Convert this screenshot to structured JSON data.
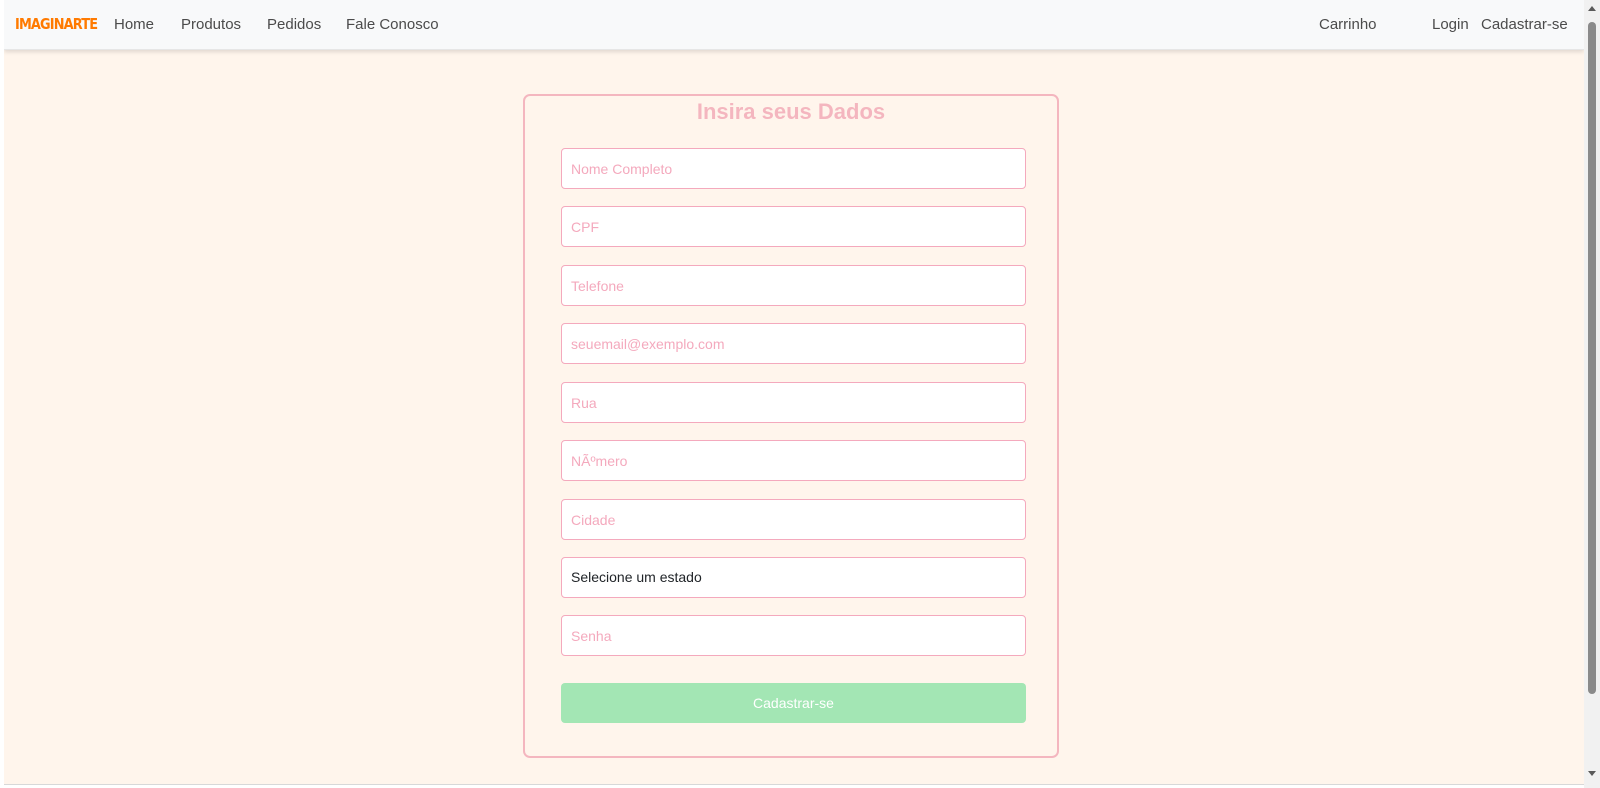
{
  "navbar": {
    "brand": "IMAGINARTE",
    "links": [
      "Home",
      "Produtos",
      "Pedidos",
      "Fale Conosco"
    ],
    "right_links": [
      "Carrinho",
      "Login",
      "Cadastrar-se"
    ]
  },
  "form": {
    "title": "Insira seus Dados",
    "fields": [
      {
        "placeholder": "Nome Completo",
        "value": ""
      },
      {
        "placeholder": "CPF",
        "value": ""
      },
      {
        "placeholder": "Telefone",
        "value": ""
      },
      {
        "placeholder": "seuemail@exemplo.com",
        "value": ""
      },
      {
        "placeholder": "Rua",
        "value": ""
      },
      {
        "placeholder": "NÃºmero",
        "value": ""
      },
      {
        "placeholder": "Cidade",
        "value": ""
      }
    ],
    "state_select": {
      "selected": "Selecione um estado"
    },
    "password": {
      "placeholder": "Senha",
      "value": ""
    },
    "submit_label": "Cadastrar-se"
  },
  "colors": {
    "brand": "#ff7a00",
    "accent_pink": "#f4b6bf",
    "submit_green": "#a3e6b4",
    "page_bg": "#fff5ec"
  }
}
